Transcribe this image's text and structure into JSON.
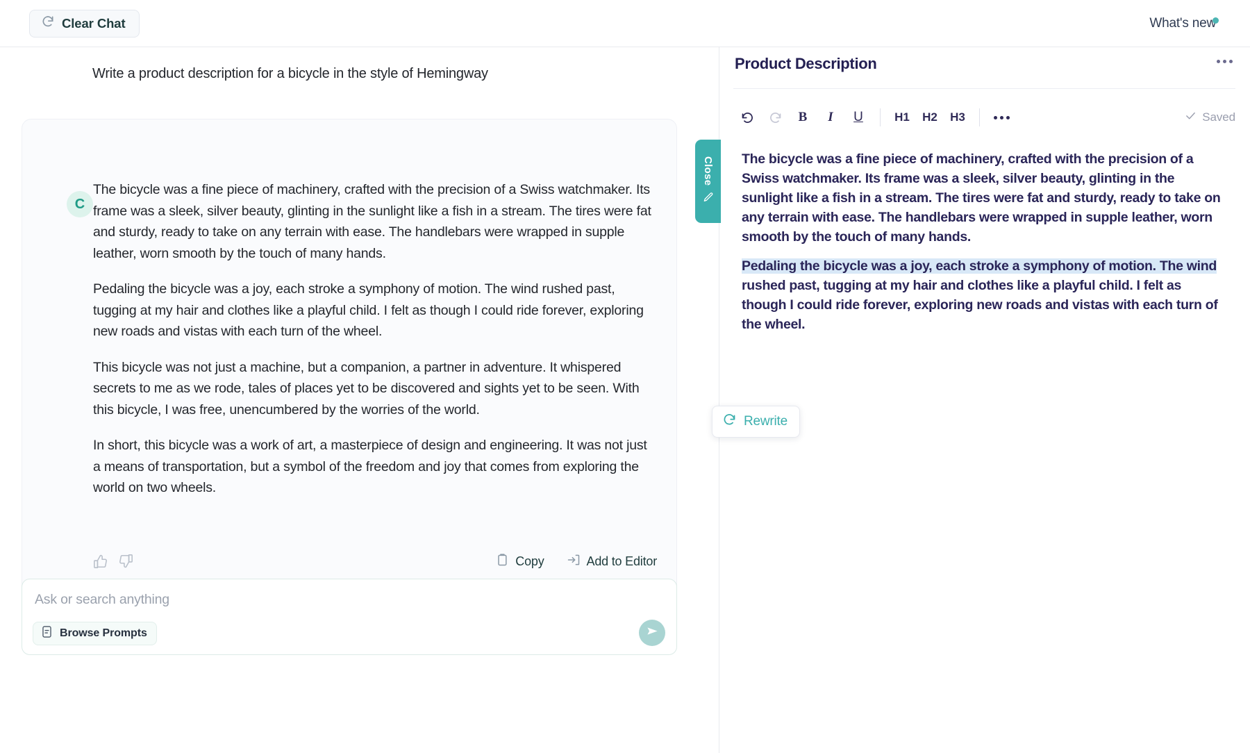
{
  "topbar": {
    "clear_chat_label": "Clear Chat",
    "whats_new_label": "What's new"
  },
  "chat": {
    "prompt": "Write a product description for a bicycle in the style of Hemingway",
    "avatar_initial": "C",
    "paragraphs": [
      "The bicycle was a fine piece of machinery, crafted with the precision of a Swiss watchmaker. Its frame was a sleek, silver beauty, glinting in the sunlight like a fish in a stream. The tires were fat and sturdy, ready to take on any terrain with ease. The handlebars were wrapped in supple leather, worn smooth by the touch of many hands.",
      "Pedaling the bicycle was a joy, each stroke a symphony of motion. The wind rushed past, tugging at my hair and clothes like a playful child. I felt as though I could ride forever, exploring new roads and vistas with each turn of the wheel.",
      "This bicycle was not just a machine, but a companion, a partner in adventure. It whispered secrets to me as we rode, tales of places yet to be discovered and sights yet to be seen. With this bicycle, I was free, unencumbered by the worries of the world.",
      "In short, this bicycle was a work of art, a masterpiece of design and engineering. It was not just a means of transportation, but a symbol of the freedom and joy that comes from exploring the world on two wheels."
    ],
    "actions": {
      "copy_label": "Copy",
      "add_to_editor_label": "Add to Editor"
    }
  },
  "composer": {
    "placeholder": "Ask or search anything",
    "value": "",
    "browse_prompts_label": "Browse Prompts"
  },
  "close_tab": {
    "label": "Close"
  },
  "editor": {
    "title": "Product Description",
    "toolbar": {
      "undo_label": "↺",
      "redo_label": "↻",
      "bold_label": "B",
      "italic_label": "I",
      "underline_label": "U",
      "h1_label": "H1",
      "h2_label": "H2",
      "h3_label": "H3"
    },
    "status_label": "Saved",
    "paragraph_1": "The bicycle was a fine piece of machinery, crafted with the precision of a Swiss watchmaker. Its frame was a sleek, silver beauty, glinting in the sunlight like a fish in a stream. The tires were fat and sturdy, ready to take on any terrain with ease. The handlebars were wrapped in supple leather, worn smooth by the touch of many hands.",
    "paragraph_2_selected": "Pedaling the bicycle was a joy, each stroke a symphony of motion. The wind",
    "paragraph_2_rest": " rushed past, tugging at my hair and clothes like a playful child. I felt as though I could ride forever, exploring new roads and vistas with each turn of the wheel."
  },
  "rewrite": {
    "label": "Rewrite"
  },
  "colors": {
    "accent_teal": "#3bafad",
    "avatar_green": "#1f9b86",
    "editor_text": "#2a2558",
    "selection_highlight": "#d8e8f7",
    "send_button": "#a9d4d2"
  }
}
